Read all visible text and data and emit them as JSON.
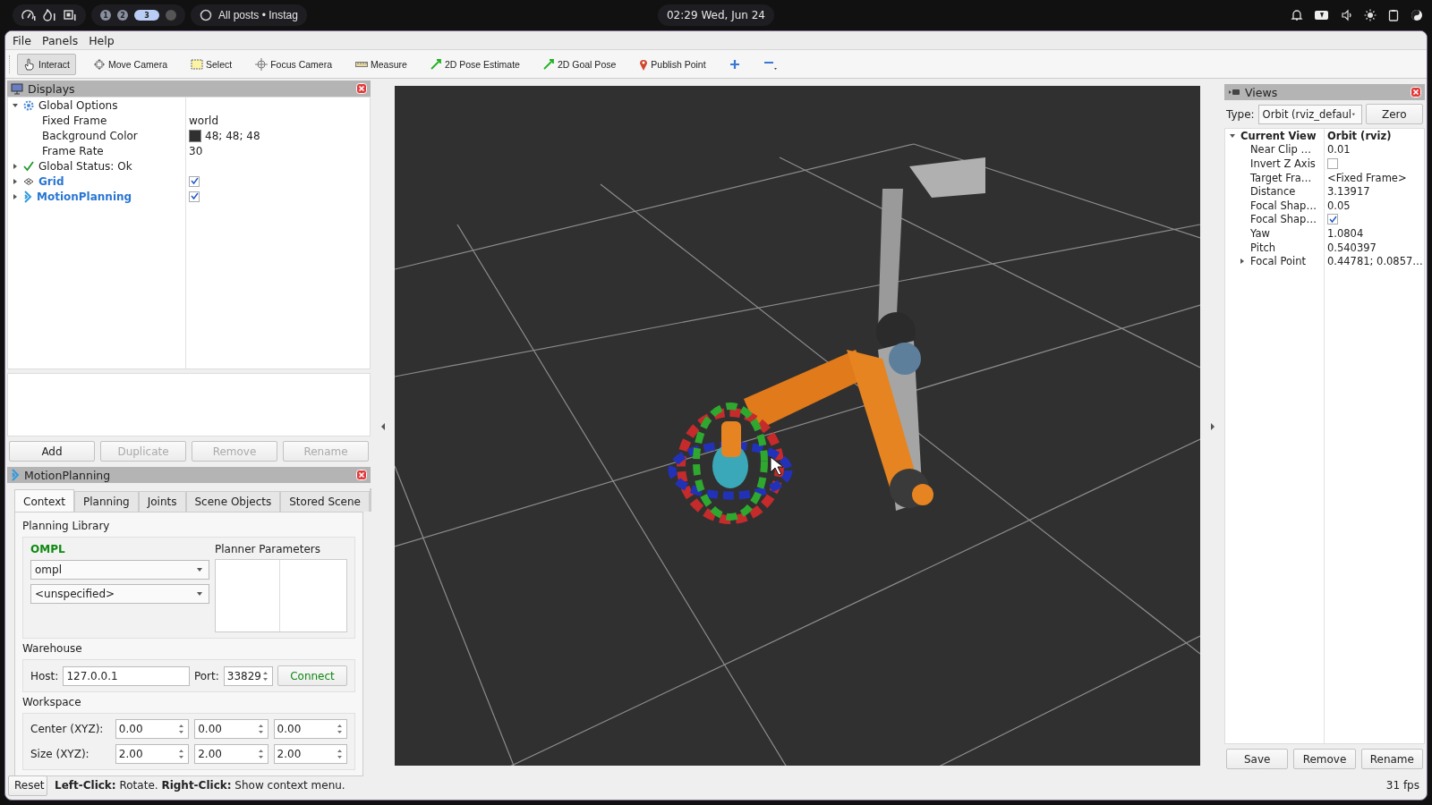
{
  "topbar": {
    "workspaces": [
      {
        "label": "1",
        "selected": false
      },
      {
        "label": "2",
        "selected": false
      },
      {
        "label": "3",
        "selected": true
      }
    ],
    "window_title": "All posts • Instag",
    "clock": "02:29 Wed, Jun 24"
  },
  "menu": [
    "File",
    "Panels",
    "Help"
  ],
  "toolbar": [
    {
      "label": "Interact",
      "selected": true
    },
    {
      "label": "Move Camera",
      "selected": false
    },
    {
      "label": "Select",
      "selected": false
    },
    {
      "label": "Focus Camera",
      "selected": false
    },
    {
      "label": "Measure",
      "selected": false
    },
    {
      "label": "2D Pose Estimate",
      "selected": false
    },
    {
      "label": "2D Goal Pose",
      "selected": false
    },
    {
      "label": "Publish Point",
      "selected": false
    }
  ],
  "displays": {
    "title": "Displays",
    "items": [
      {
        "label": "Global Options",
        "kind": "options",
        "expanded": true,
        "children": [
          {
            "label": "Fixed Frame",
            "kind": "text",
            "value": "world"
          },
          {
            "label": "Background Color",
            "kind": "color",
            "value": "48; 48; 48",
            "color": "#303030"
          },
          {
            "label": "Frame Rate",
            "kind": "text",
            "value": "30"
          }
        ]
      },
      {
        "label": "Global Status: Ok",
        "kind": "status",
        "expanded": false
      },
      {
        "label": "Grid",
        "kind": "display",
        "expanded": false,
        "checked": true
      },
      {
        "label": "MotionPlanning",
        "kind": "display",
        "expanded": false,
        "checked": true
      }
    ],
    "buttons": [
      {
        "label": "Add",
        "disabled": false
      },
      {
        "label": "Duplicate",
        "disabled": true
      },
      {
        "label": "Remove",
        "disabled": true
      },
      {
        "label": "Rename",
        "disabled": true
      }
    ]
  },
  "motion_planning": {
    "title": "MotionPlanning",
    "tabs": [
      {
        "label": "Context",
        "selected": true
      },
      {
        "label": "Planning",
        "selected": false
      },
      {
        "label": "Joints",
        "selected": false
      },
      {
        "label": "Scene Objects",
        "selected": false
      },
      {
        "label": "Stored Scene",
        "selected": false
      }
    ],
    "planning_library": {
      "heading": "Planning Library",
      "library": "OMPL",
      "dropdowns": [
        "ompl",
        "<unspecified>"
      ],
      "parameters_heading": "Planner Parameters"
    },
    "warehouse": {
      "heading": "Warehouse",
      "host_label": "Host:",
      "host": "127.0.0.1",
      "port_label": "Port:",
      "port": "33829",
      "connect": "Connect"
    },
    "workspace": {
      "heading": "Workspace",
      "rows": [
        {
          "label": "Center (XYZ):",
          "values": [
            "0.00",
            "0.00",
            "0.00"
          ]
        },
        {
          "label": "Size (XYZ):",
          "values": [
            "2.00",
            "2.00",
            "2.00"
          ]
        }
      ]
    }
  },
  "views": {
    "title": "Views",
    "type_label": "Type:",
    "type": "Orbit (rviz_defaul",
    "zero": "Zero",
    "items": [
      {
        "label": "Current View",
        "value": "Orbit (rviz)",
        "expanded": true,
        "children": [
          {
            "label": "Near Clip …",
            "kind": "text",
            "value": "0.01"
          },
          {
            "label": "Invert Z Axis",
            "kind": "checkbox",
            "checked": false
          },
          {
            "label": "Target Fra…",
            "kind": "text",
            "value": "<Fixed Frame>"
          },
          {
            "label": "Distance",
            "kind": "text",
            "value": "3.13917"
          },
          {
            "label": "Focal Shap…",
            "kind": "text",
            "value": "0.05"
          },
          {
            "label": "Focal Shap…",
            "kind": "checkbox",
            "checked": true
          },
          {
            "label": "Yaw",
            "kind": "text",
            "value": "1.0804"
          },
          {
            "label": "Pitch",
            "kind": "text",
            "value": "0.540397"
          },
          {
            "label": "Focal Point",
            "kind": "text",
            "value": "0.44781; 0.0857…",
            "expanded": false
          }
        ]
      }
    ],
    "buttons": [
      "Save",
      "Remove",
      "Rename"
    ]
  },
  "status_bar": {
    "reset": "Reset",
    "hint": "**Left-Click:** Rotate. **Right-Click:** Show context menu.",
    "fps": "31 fps"
  }
}
